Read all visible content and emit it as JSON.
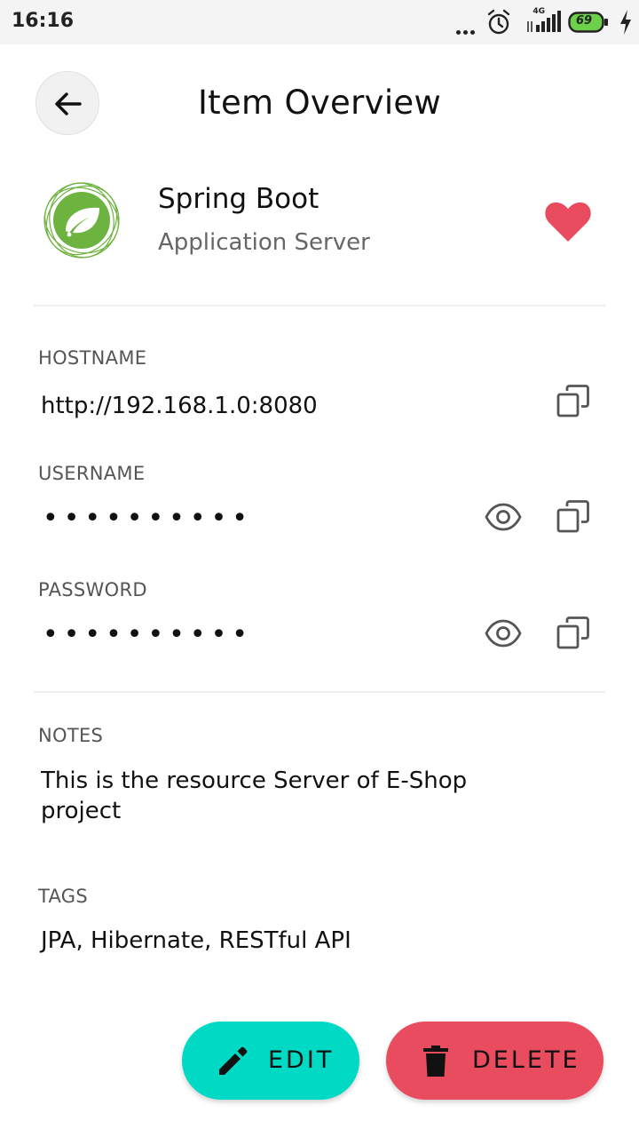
{
  "status_bar": {
    "time": "16:16",
    "network_label": "4G",
    "battery": "69"
  },
  "header": {
    "title": "Item Overview",
    "back_icon": "arrow-left-icon"
  },
  "item": {
    "name": "Spring Boot",
    "type": "Application Server",
    "logo_icon": "spring-leaf-icon",
    "favorite": true,
    "favorite_color": "#e94b5f"
  },
  "fields": {
    "hostname": {
      "label": "HOSTNAME",
      "value": "http://192.168.1.0:8080"
    },
    "username": {
      "label": "USERNAME",
      "value": "••••••••••"
    },
    "password": {
      "label": "PASSWORD",
      "value": "••••••••••"
    }
  },
  "notes": {
    "label": "NOTES",
    "text": "This is the resource Server of E-Shop project"
  },
  "tags": {
    "label": "TAGS",
    "text": "JPA, Hibernate, RESTful API"
  },
  "actions": {
    "edit_label": "EDIT",
    "delete_label": "DELETE",
    "edit_color": "#00d9c4",
    "delete_color": "#e94b5f"
  }
}
